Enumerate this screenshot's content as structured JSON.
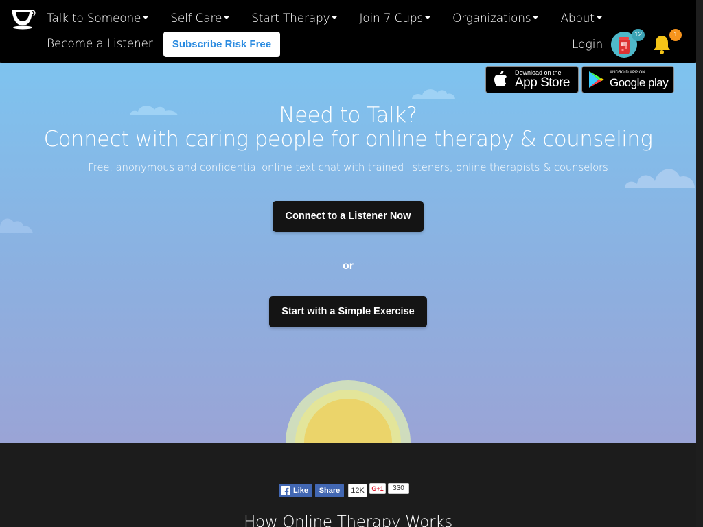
{
  "nav": {
    "items": [
      {
        "label": "Talk to Someone"
      },
      {
        "label": "Self Care"
      },
      {
        "label": "Start Therapy"
      },
      {
        "label": "Join 7 Cups"
      },
      {
        "label": "Organizations"
      },
      {
        "label": "About"
      }
    ],
    "become_listener": "Become a Listener",
    "subscribe": "Subscribe Risk Free",
    "login": "Login",
    "avatar_badge": "12",
    "notification_badge": "1"
  },
  "stores": {
    "appstore_small": "Download on the",
    "appstore_big": "App Store",
    "gplay_small": "ANDROID APP ON",
    "gplay_big": "Google play"
  },
  "hero": {
    "title_line1": "Need to Talk?",
    "title_line2": "Connect with caring people for online therapy & counseling",
    "subtitle": "Free, anonymous and confidential online text chat with trained listeners, online therapists & counselors",
    "cta_primary": "Connect to a Listener Now",
    "or": "or",
    "cta_secondary": "Start with a Simple Exercise"
  },
  "social": {
    "fb_like": "Like",
    "fb_share": "Share",
    "fb_count": "12K",
    "gplus": "G+1",
    "gplus_count": "330"
  },
  "section": {
    "heading": "How Online Therapy Works"
  },
  "colors": {
    "nav_bg": "#000000",
    "accent_blue": "#2b8be0",
    "teal_badge": "#3ba3b5",
    "orange_badge": "#f7941d",
    "cta_bg": "#141414"
  }
}
